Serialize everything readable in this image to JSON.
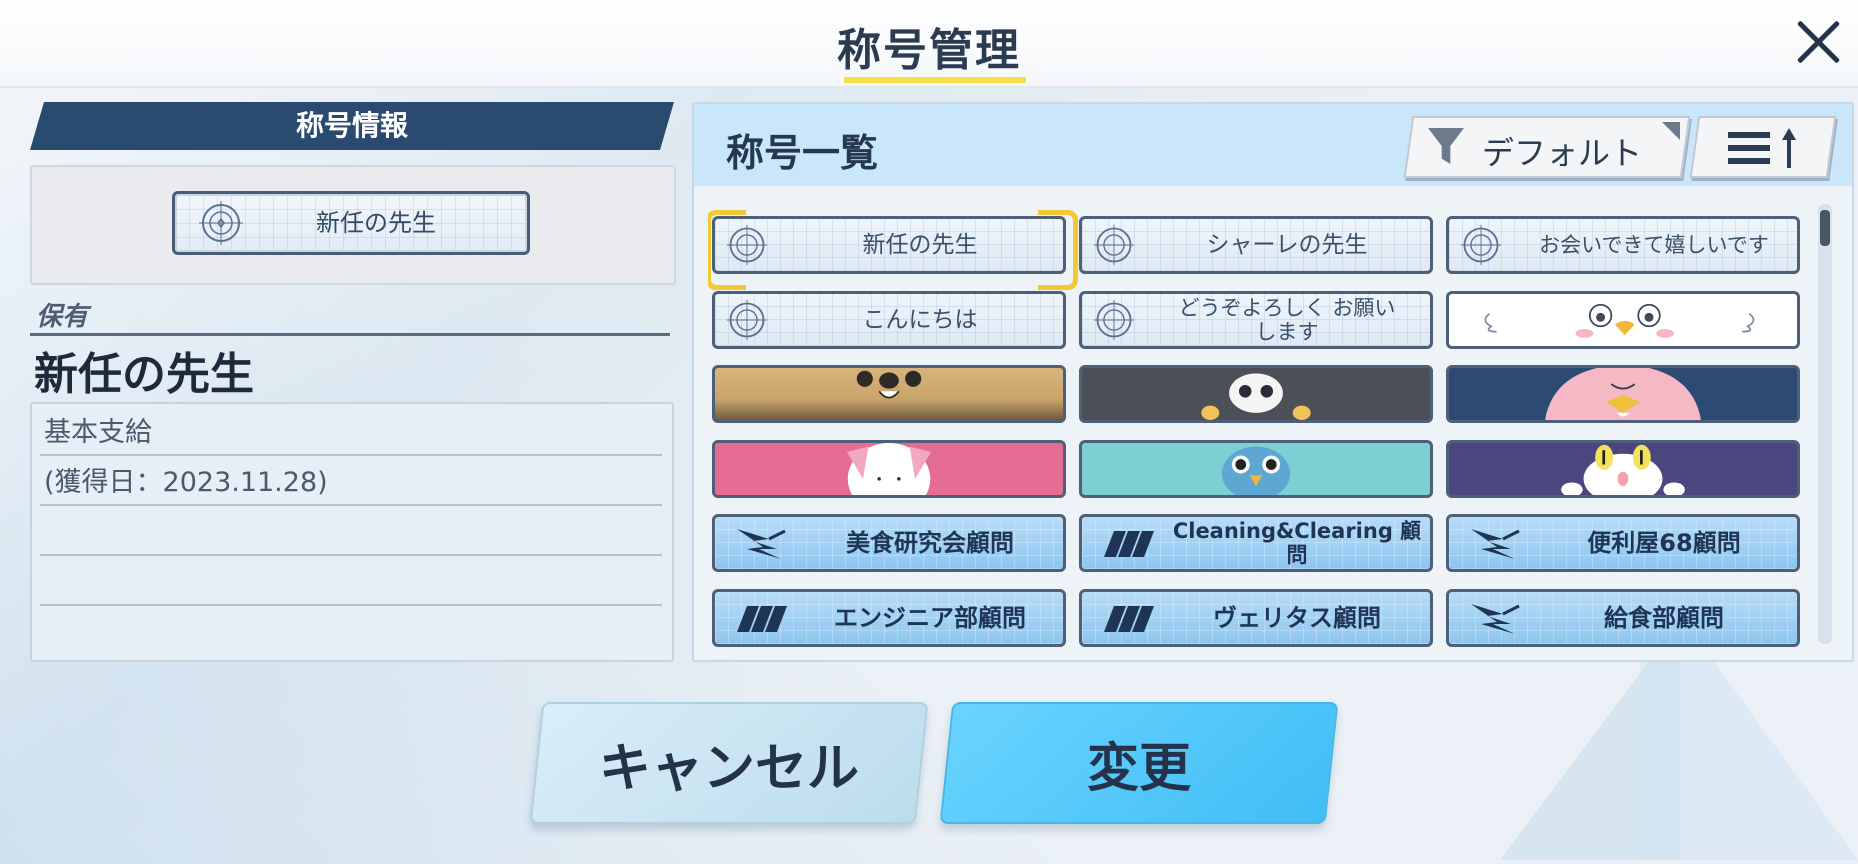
{
  "header": {
    "title": "称号管理"
  },
  "left_panel": {
    "section_header": "称号情報",
    "current_title": "新任の先生",
    "owned_label": "保有",
    "owned_title": "新任の先生",
    "description": [
      "基本支給",
      "(獲得日：2023.11.28)"
    ]
  },
  "right_panel": {
    "title": "称号一覧",
    "sort_label": "デフォルト",
    "tiles": [
      {
        "type": "text",
        "label": "新任の先生",
        "selected": true
      },
      {
        "type": "text",
        "label": "シャーレの先生"
      },
      {
        "type": "text",
        "label": "お会いできて嬉しいです"
      },
      {
        "type": "text",
        "label": "こんにちは"
      },
      {
        "type": "text",
        "label": "どうぞよろしく お願いします"
      },
      {
        "type": "image",
        "icon": "bird-face-icon"
      },
      {
        "type": "image",
        "icon": "dog-face-icon"
      },
      {
        "type": "image",
        "icon": "skull-icon"
      },
      {
        "type": "image",
        "icon": "penguin-icon"
      },
      {
        "type": "image",
        "icon": "rabbit-icon"
      },
      {
        "type": "image",
        "icon": "owl-icon"
      },
      {
        "type": "image",
        "icon": "cat-face-icon"
      },
      {
        "type": "club",
        "label": "美食研究会顧問",
        "icon": "wing-logo-icon"
      },
      {
        "type": "club",
        "label": "Cleaning&Clearing 顧問",
        "icon": "millennium-logo-icon"
      },
      {
        "type": "club",
        "label": "便利屋68顧問",
        "icon": "wing-logo-icon"
      },
      {
        "type": "club",
        "label": "エンジニア部顧問",
        "icon": "millennium-logo-icon"
      },
      {
        "type": "club",
        "label": "ヴェリタス顧問",
        "icon": "millennium-logo-icon"
      },
      {
        "type": "club",
        "label": "給食部顧問",
        "icon": "wing-logo-icon"
      }
    ]
  },
  "buttons": {
    "cancel": "キャンセル",
    "change": "変更"
  },
  "colors": {
    "accent_yellow": "#f5e04a",
    "header_navy": "#2b4a6f",
    "confirm_blue": "#40bdf5"
  }
}
